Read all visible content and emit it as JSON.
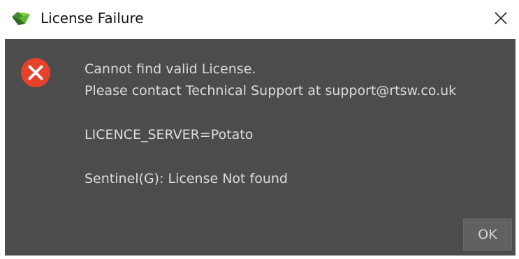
{
  "window": {
    "title": "License Failure"
  },
  "message": {
    "line1": "Cannot find valid License.",
    "line2": "Please contact Technical Support at support@rtsw.co.uk",
    "line3": "LICENCE_SERVER=Potato",
    "line4": "Sentinel(G): License Not found"
  },
  "buttons": {
    "ok_label": "OK"
  },
  "icons": {
    "app": "app-logo-icon",
    "error": "error-icon",
    "close": "close-icon"
  },
  "colors": {
    "content_background": "#4c4c4c",
    "error_red": "#e8412a",
    "app_logo_green": "#5cb82e",
    "text": "#dcdcdc"
  }
}
